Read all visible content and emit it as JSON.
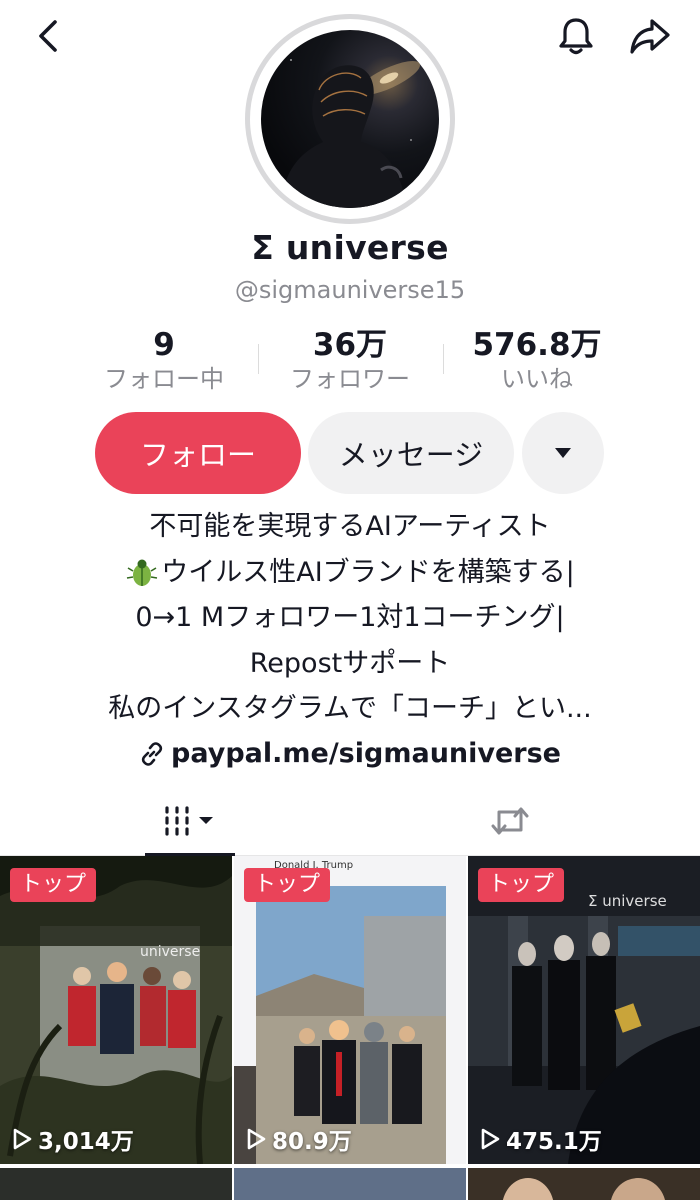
{
  "header": {
    "back_icon": "chevron-left-icon",
    "bell_icon": "bell-icon",
    "share_icon": "share-arrow-icon"
  },
  "profile": {
    "display_name": "Σ universe",
    "handle": "@sigmauniverse15"
  },
  "stats": [
    {
      "value": "9",
      "label": "フォロー中"
    },
    {
      "value": "36万",
      "label": "フォロワー"
    },
    {
      "value": "576.8万",
      "label": "いいね"
    }
  ],
  "actions": {
    "follow_label": "フォロー",
    "message_label": "メッセージ",
    "more_icon": "caret-down-icon"
  },
  "bio": {
    "lines": [
      "不可能を実現するAIアーティスト",
      "ウイルス性AIブランドを構築する|",
      "0→1 Mフォロワー1対1コーチング|",
      "Repostサポート",
      "私のインスタグラムで「コーチ」とい..."
    ],
    "link": "paypal.me/sigmauniverse"
  },
  "tabs": {
    "videos_icon": "grid-icon",
    "reposts_icon": "repost-icon"
  },
  "videos": [
    {
      "badge": "トップ",
      "views": "3,014万",
      "watermark": "universe"
    },
    {
      "badge": "トップ",
      "views": "80.9万",
      "watermark": "Donald J. Trump"
    },
    {
      "badge": "トップ",
      "views": "475.1万",
      "watermark": "Σ universe"
    }
  ],
  "colors": {
    "accent": "#ea4359",
    "text": "#161823",
    "muted": "#8a8b91",
    "button_bg": "#f1f1f2"
  }
}
